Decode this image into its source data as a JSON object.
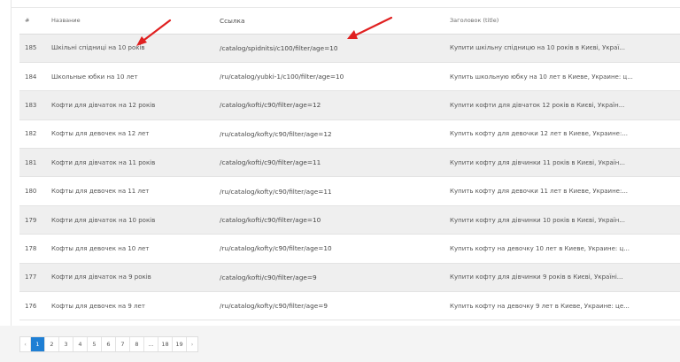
{
  "table": {
    "headers": {
      "id": "#",
      "name": "Название",
      "link": "Ссылка",
      "title": "Заголовок (title)"
    },
    "rows": [
      {
        "id": "185",
        "name": "Шкільні спідниці на 10 років",
        "link": "/catalog/spidnitsi/c100/filter/age=10",
        "title": "Купити шкільну спідницю на 10 років в Києві, Украї..."
      },
      {
        "id": "184",
        "name": "Школьные юбки на 10 лет",
        "link": "/ru/catalog/yubki-1/c100/filter/age=10",
        "title": "Купить школьную юбку на 10 лет в Киеве, Украине: ц..."
      },
      {
        "id": "183",
        "name": "Кофти для дівчаток на 12 років",
        "link": "/catalog/kofti/c90/filter/age=12",
        "title": "Купити кофти для дівчаток 12 років в Києві, Україн..."
      },
      {
        "id": "182",
        "name": "Кофты для девочек на 12 лет",
        "link": "/ru/catalog/kofty/c90/filter/age=12",
        "title": "Купить кофту для девочки 12 лет в Киеве, Украине:..."
      },
      {
        "id": "181",
        "name": "Кофти для дівчаток на 11 років",
        "link": "/catalog/kofti/c90/filter/age=11",
        "title": "Купити кофту для дівчинки 11 років в Києві, Україн..."
      },
      {
        "id": "180",
        "name": "Кофты для девочек на 11 лет",
        "link": "/ru/catalog/kofty/c90/filter/age=11",
        "title": "Купить кофту для девочки 11 лет в Киеве, Украине:..."
      },
      {
        "id": "179",
        "name": "Кофти для дівчаток на 10 років",
        "link": "/catalog/kofti/c90/filter/age=10",
        "title": "Купити кофту для дівчинки 10 років в Києві, Україн..."
      },
      {
        "id": "178",
        "name": "Кофты для девочек на 10 лет",
        "link": "/ru/catalog/kofty/c90/filter/age=10",
        "title": "Купить кофту на девочку 10 лет в Киеве, Украине: ц..."
      },
      {
        "id": "177",
        "name": "Кофти для дівчаток на 9 років",
        "link": "/catalog/kofti/c90/filter/age=9",
        "title": "Купити кофту для дівчинки 9 років в Києві, Україні..."
      },
      {
        "id": "176",
        "name": "Кофты для девочек на 9 лет",
        "link": "/ru/catalog/kofty/c90/filter/age=9",
        "title": "Купить кофту на девочку 9 лет в Киеве, Украине: це..."
      }
    ]
  },
  "pagination": {
    "prev": "‹",
    "pages": [
      "1",
      "2",
      "3",
      "4",
      "5",
      "6",
      "7",
      "8",
      "...",
      "18",
      "19"
    ],
    "next": "›",
    "active_page": "1"
  },
  "colors": {
    "accent": "#1f7fd4",
    "arrow": "#e02020"
  }
}
